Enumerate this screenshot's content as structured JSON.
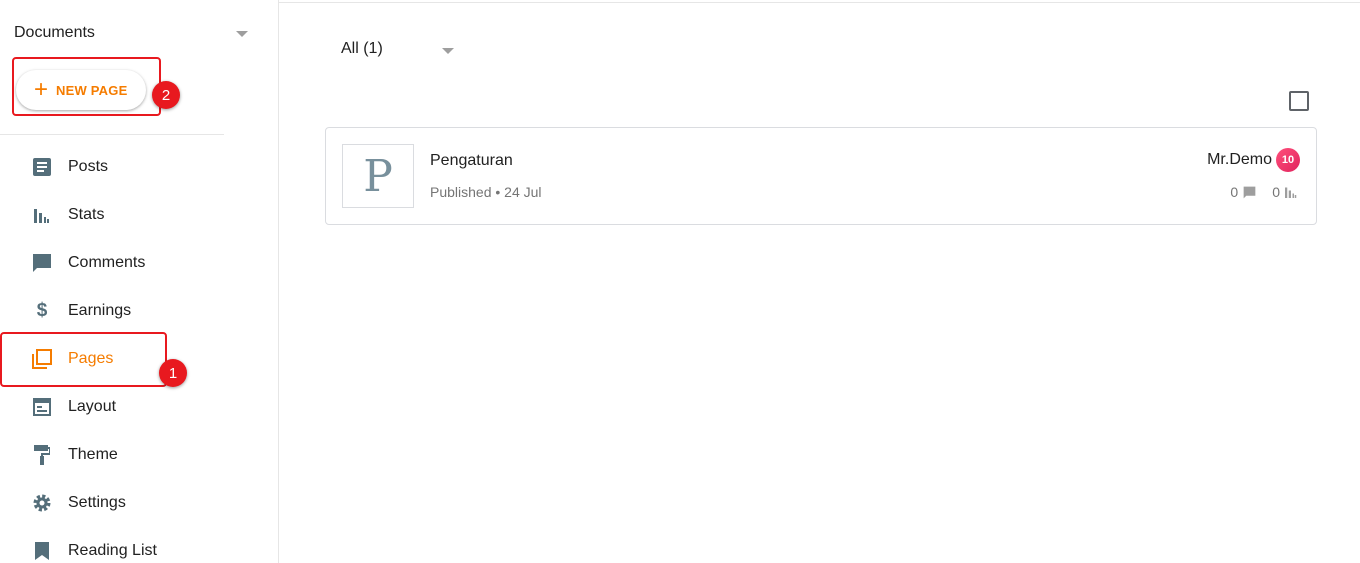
{
  "sidebar": {
    "blog_selector": "Documents",
    "new_page_label": "NEW PAGE",
    "items": [
      {
        "label": "Posts",
        "icon": "posts-icon"
      },
      {
        "label": "Stats",
        "icon": "stats-icon"
      },
      {
        "label": "Comments",
        "icon": "comments-icon"
      },
      {
        "label": "Earnings",
        "icon": "dollar-icon"
      },
      {
        "label": "Pages",
        "icon": "pages-icon",
        "active": true
      },
      {
        "label": "Layout",
        "icon": "layout-icon"
      },
      {
        "label": "Theme",
        "icon": "paint-roller-icon"
      },
      {
        "label": "Settings",
        "icon": "gear-icon"
      },
      {
        "label": "Reading List",
        "icon": "bookmark-icon"
      }
    ]
  },
  "annotations": {
    "step1": "1",
    "step2": "2"
  },
  "main": {
    "filter_label": "All (1)",
    "pages": [
      {
        "thumb_letter": "P",
        "title": "Pengaturan",
        "meta": "Published • 24 Jul",
        "author": "Mr.Demo",
        "avatar_text": "10",
        "comments": "0",
        "views": "0"
      }
    ]
  },
  "colors": {
    "accent": "#f57c00",
    "icon": "#546e7a",
    "annotation": "#e8191f"
  }
}
